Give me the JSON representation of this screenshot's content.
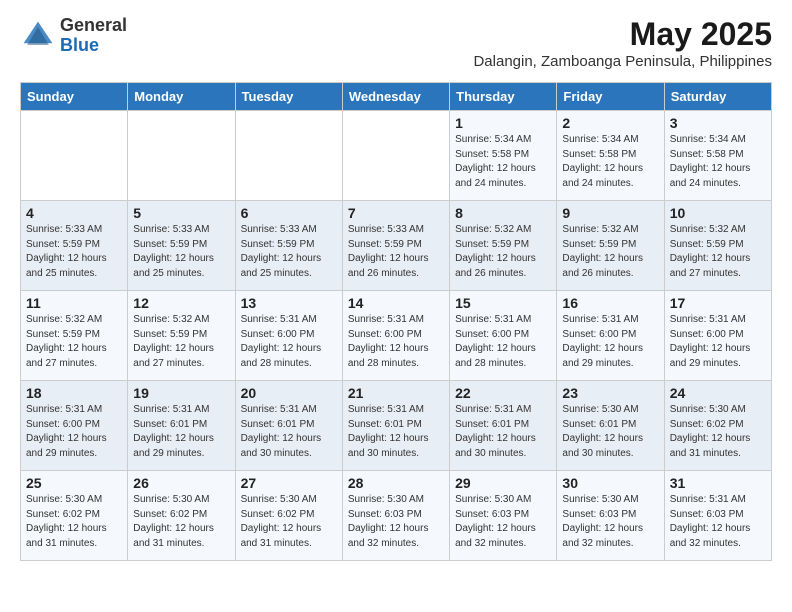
{
  "logo": {
    "general": "General",
    "blue": "Blue"
  },
  "title": "May 2025",
  "subtitle": "Dalangin, Zamboanga Peninsula, Philippines",
  "weekdays": [
    "Sunday",
    "Monday",
    "Tuesday",
    "Wednesday",
    "Thursday",
    "Friday",
    "Saturday"
  ],
  "weeks": [
    [
      {
        "day": "",
        "info": ""
      },
      {
        "day": "",
        "info": ""
      },
      {
        "day": "",
        "info": ""
      },
      {
        "day": "",
        "info": ""
      },
      {
        "day": "1",
        "info": "Sunrise: 5:34 AM\nSunset: 5:58 PM\nDaylight: 12 hours\nand 24 minutes."
      },
      {
        "day": "2",
        "info": "Sunrise: 5:34 AM\nSunset: 5:58 PM\nDaylight: 12 hours\nand 24 minutes."
      },
      {
        "day": "3",
        "info": "Sunrise: 5:34 AM\nSunset: 5:58 PM\nDaylight: 12 hours\nand 24 minutes."
      }
    ],
    [
      {
        "day": "4",
        "info": "Sunrise: 5:33 AM\nSunset: 5:59 PM\nDaylight: 12 hours\nand 25 minutes."
      },
      {
        "day": "5",
        "info": "Sunrise: 5:33 AM\nSunset: 5:59 PM\nDaylight: 12 hours\nand 25 minutes."
      },
      {
        "day": "6",
        "info": "Sunrise: 5:33 AM\nSunset: 5:59 PM\nDaylight: 12 hours\nand 25 minutes."
      },
      {
        "day": "7",
        "info": "Sunrise: 5:33 AM\nSunset: 5:59 PM\nDaylight: 12 hours\nand 26 minutes."
      },
      {
        "day": "8",
        "info": "Sunrise: 5:32 AM\nSunset: 5:59 PM\nDaylight: 12 hours\nand 26 minutes."
      },
      {
        "day": "9",
        "info": "Sunrise: 5:32 AM\nSunset: 5:59 PM\nDaylight: 12 hours\nand 26 minutes."
      },
      {
        "day": "10",
        "info": "Sunrise: 5:32 AM\nSunset: 5:59 PM\nDaylight: 12 hours\nand 27 minutes."
      }
    ],
    [
      {
        "day": "11",
        "info": "Sunrise: 5:32 AM\nSunset: 5:59 PM\nDaylight: 12 hours\nand 27 minutes."
      },
      {
        "day": "12",
        "info": "Sunrise: 5:32 AM\nSunset: 5:59 PM\nDaylight: 12 hours\nand 27 minutes."
      },
      {
        "day": "13",
        "info": "Sunrise: 5:31 AM\nSunset: 6:00 PM\nDaylight: 12 hours\nand 28 minutes."
      },
      {
        "day": "14",
        "info": "Sunrise: 5:31 AM\nSunset: 6:00 PM\nDaylight: 12 hours\nand 28 minutes."
      },
      {
        "day": "15",
        "info": "Sunrise: 5:31 AM\nSunset: 6:00 PM\nDaylight: 12 hours\nand 28 minutes."
      },
      {
        "day": "16",
        "info": "Sunrise: 5:31 AM\nSunset: 6:00 PM\nDaylight: 12 hours\nand 29 minutes."
      },
      {
        "day": "17",
        "info": "Sunrise: 5:31 AM\nSunset: 6:00 PM\nDaylight: 12 hours\nand 29 minutes."
      }
    ],
    [
      {
        "day": "18",
        "info": "Sunrise: 5:31 AM\nSunset: 6:00 PM\nDaylight: 12 hours\nand 29 minutes."
      },
      {
        "day": "19",
        "info": "Sunrise: 5:31 AM\nSunset: 6:01 PM\nDaylight: 12 hours\nand 29 minutes."
      },
      {
        "day": "20",
        "info": "Sunrise: 5:31 AM\nSunset: 6:01 PM\nDaylight: 12 hours\nand 30 minutes."
      },
      {
        "day": "21",
        "info": "Sunrise: 5:31 AM\nSunset: 6:01 PM\nDaylight: 12 hours\nand 30 minutes."
      },
      {
        "day": "22",
        "info": "Sunrise: 5:31 AM\nSunset: 6:01 PM\nDaylight: 12 hours\nand 30 minutes."
      },
      {
        "day": "23",
        "info": "Sunrise: 5:30 AM\nSunset: 6:01 PM\nDaylight: 12 hours\nand 30 minutes."
      },
      {
        "day": "24",
        "info": "Sunrise: 5:30 AM\nSunset: 6:02 PM\nDaylight: 12 hours\nand 31 minutes."
      }
    ],
    [
      {
        "day": "25",
        "info": "Sunrise: 5:30 AM\nSunset: 6:02 PM\nDaylight: 12 hours\nand 31 minutes."
      },
      {
        "day": "26",
        "info": "Sunrise: 5:30 AM\nSunset: 6:02 PM\nDaylight: 12 hours\nand 31 minutes."
      },
      {
        "day": "27",
        "info": "Sunrise: 5:30 AM\nSunset: 6:02 PM\nDaylight: 12 hours\nand 31 minutes."
      },
      {
        "day": "28",
        "info": "Sunrise: 5:30 AM\nSunset: 6:03 PM\nDaylight: 12 hours\nand 32 minutes."
      },
      {
        "day": "29",
        "info": "Sunrise: 5:30 AM\nSunset: 6:03 PM\nDaylight: 12 hours\nand 32 minutes."
      },
      {
        "day": "30",
        "info": "Sunrise: 5:30 AM\nSunset: 6:03 PM\nDaylight: 12 hours\nand 32 minutes."
      },
      {
        "day": "31",
        "info": "Sunrise: 5:31 AM\nSunset: 6:03 PM\nDaylight: 12 hours\nand 32 minutes."
      }
    ]
  ]
}
